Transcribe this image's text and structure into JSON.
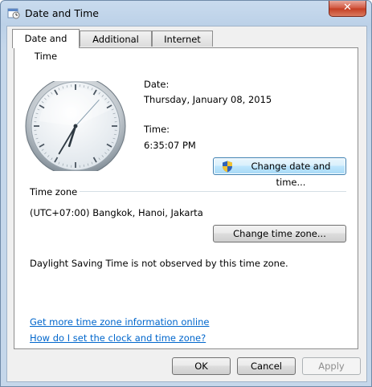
{
  "window": {
    "title": "Date and Time",
    "close_label": "✕"
  },
  "tabs": [
    {
      "label": "Date and Time"
    },
    {
      "label": "Additional Clocks"
    },
    {
      "label": "Internet Time"
    }
  ],
  "clock": {
    "hour": 6,
    "minute": 35,
    "second": 7
  },
  "date": {
    "label": "Date:",
    "value": "Thursday, January 08, 2015"
  },
  "time": {
    "label": "Time:",
    "value": "6:35:07 PM"
  },
  "change_datetime_label": "Change date and time...",
  "timezone": {
    "section_label": "Time zone",
    "value": "(UTC+07:00) Bangkok, Hanoi, Jakarta",
    "change_label": "Change time zone...",
    "dst_text": "Daylight Saving Time is not observed by this time zone."
  },
  "links": {
    "more_info": "Get more time zone information online",
    "how_to": "How do I set the clock and time zone?"
  },
  "footer": {
    "ok": "OK",
    "cancel": "Cancel",
    "apply": "Apply"
  }
}
